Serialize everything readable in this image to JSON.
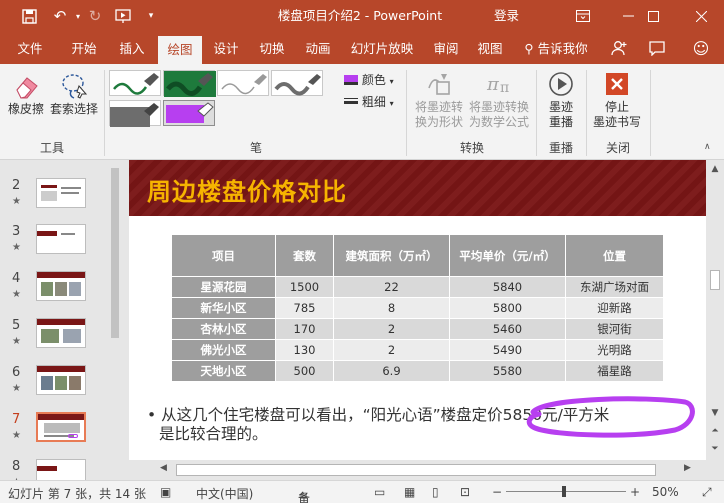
{
  "window": {
    "title": "楼盘项目介绍2  -  PowerPoint",
    "login_label": "登录"
  },
  "tabs": [
    "文件",
    "开始",
    "插入",
    "绘图",
    "设计",
    "切换",
    "动画",
    "幻灯片放映",
    "审阅",
    "视图"
  ],
  "active_tab": "绘图",
  "tell_me": "告诉我你",
  "ribbon": {
    "tools": {
      "eraser": "橡皮擦",
      "lasso": "套索选择",
      "group_label": "工具"
    },
    "pens": {
      "color_label": "颜色",
      "thickness_label": "粗细",
      "group_label": "笔",
      "swatches": [
        "#1e7a3c",
        "#1e7a3c",
        "#9a9a9a",
        "#6d6d6d",
        "#6d6d6d",
        "#b73ff0"
      ]
    },
    "convert": {
      "to_shape_line1": "将墨迹转",
      "to_shape_line2": "换为形状",
      "to_math_line1": "将墨迹转换",
      "to_math_line2": "为数学公式",
      "group_label": "转换"
    },
    "replay": {
      "label_line1": "墨迹",
      "label_line2": "重播",
      "group_label": "重播"
    },
    "close": {
      "label_line1": "停止",
      "label_line2": "墨迹书写",
      "group_label": "关闭"
    }
  },
  "thumbnails": [
    {
      "num": "2",
      "star": "★"
    },
    {
      "num": "3",
      "star": "★"
    },
    {
      "num": "4",
      "star": "★"
    },
    {
      "num": "5",
      "star": "★"
    },
    {
      "num": "6",
      "star": "★"
    },
    {
      "num": "7",
      "star": "★"
    },
    {
      "num": "8",
      "star": "★"
    }
  ],
  "current_slide_index": 5,
  "slide": {
    "title": "周边楼盘价格对比",
    "table": {
      "headers": [
        "项目",
        "套数",
        "建筑面积（万㎡）",
        "平均单价（元/㎡）",
        "位置"
      ],
      "rows": [
        [
          "星源花园",
          "1500",
          "22",
          "5840",
          "东湖广场对面"
        ],
        [
          "新华小区",
          "785",
          "8",
          "5800",
          "迎新路"
        ],
        [
          "杏林小区",
          "170",
          "2",
          "5460",
          "银河街"
        ],
        [
          "佛光小区",
          "130",
          "2",
          "5490",
          "光明路"
        ],
        [
          "天地小区",
          "500",
          "6.9",
          "5580",
          "福星路"
        ]
      ]
    },
    "bullet_line1": "从这几个住宅楼盘可以看出，“阳光心语”楼盘定价5850元/平方米",
    "bullet_line2": "是比较合理的。",
    "ink_color": "#b73ff0"
  },
  "status": {
    "slide_info": "幻灯片 第 7 张，共 14 张",
    "language": "中文(中国)",
    "notes": "备注",
    "zoom": "50%"
  }
}
